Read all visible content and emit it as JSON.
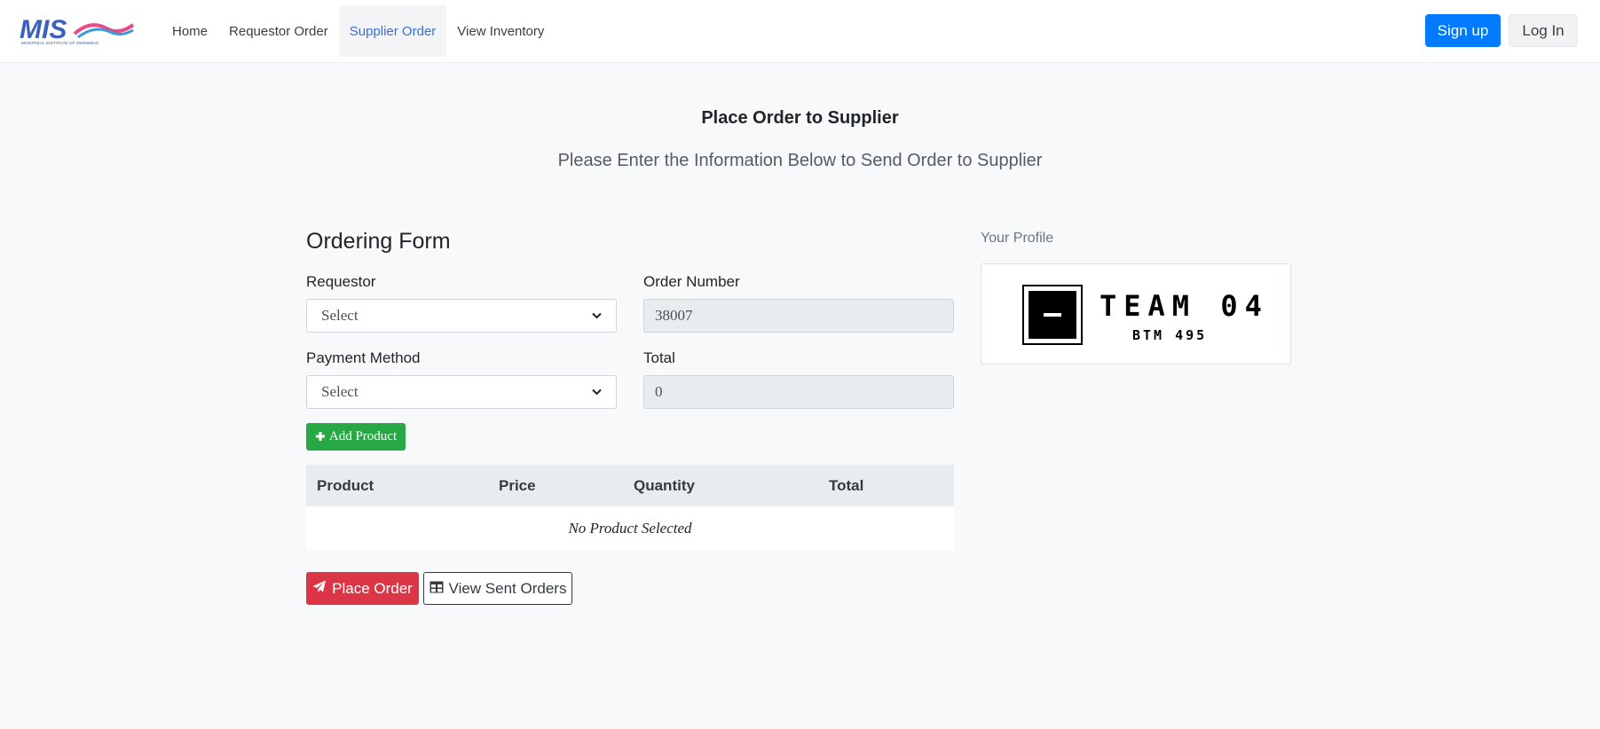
{
  "navbar": {
    "logo": {
      "text": "MIS",
      "tagline": "MONTREAL INSTITUTE OF SWIMMING",
      "colors": {
        "primary": "#3a5fbf",
        "wave": "#e84a8a"
      }
    },
    "links": [
      {
        "label": "Home",
        "active": false
      },
      {
        "label": "Requestor Order",
        "active": false
      },
      {
        "label": "Supplier Order",
        "active": true
      },
      {
        "label": "View Inventory",
        "active": false
      }
    ],
    "signup_label": "Sign up",
    "login_label": "Log In"
  },
  "page": {
    "title": "Place Order to Supplier",
    "subtitle": "Please Enter the Information Below to Send Order to Supplier"
  },
  "form": {
    "title": "Ordering Form",
    "requestor": {
      "label": "Requestor",
      "value": "Select"
    },
    "order_number": {
      "label": "Order Number",
      "value": "38007"
    },
    "payment_method": {
      "label": "Payment Method",
      "value": "Select"
    },
    "total": {
      "label": "Total",
      "value": "0"
    },
    "add_product_label": "Add Product",
    "table": {
      "headers": [
        "Product",
        "Price",
        "Quantity",
        "Total"
      ],
      "empty_text": "No Product Selected"
    },
    "place_order_label": "Place Order",
    "view_sent_orders_label": "View Sent Orders"
  },
  "profile": {
    "label": "Your Profile",
    "team_name": "TEAM 04",
    "team_sub": "BTM 495"
  },
  "colors": {
    "primary": "#007bff",
    "success": "#28a745",
    "danger": "#dc3545",
    "active_link": "#3a6fd8"
  },
  "icons": {
    "add_product": "plus-icon",
    "place_order": "paper-plane-icon",
    "view_sent_orders": "table-icon",
    "select": "chevron-down-icon"
  }
}
